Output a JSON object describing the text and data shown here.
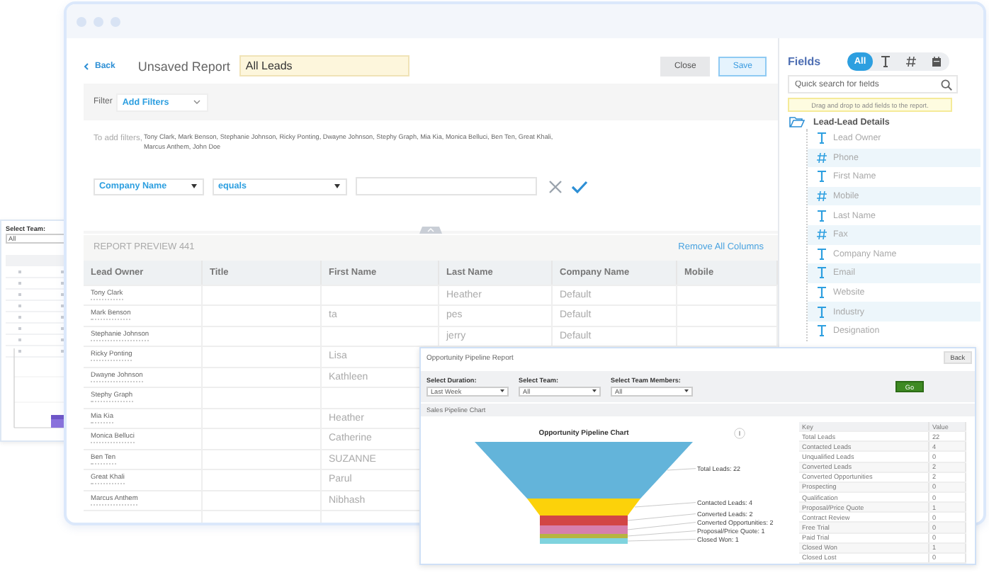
{
  "side_window": {
    "label": "Select Team:",
    "value": "All"
  },
  "header": {
    "back": "Back",
    "title": "Unsaved Report",
    "report_name": "All Leads",
    "buttons": [
      {
        "label": "Close",
        "kind": "secondary"
      },
      {
        "label": "Save",
        "kind": "primary"
      }
    ]
  },
  "filter": {
    "label": "Filter",
    "add_filters": "Add Filters",
    "hint": "To add filters,",
    "names": "Tony Clark, Mark Benson, Stephanie Johnson, Ricky Ponting, Dwayne Johnson, Stephy Graph, Mia Kia, Monica Belluci, Ben Ten, Great Khali, Marcus Anthem, John Doe",
    "field": "Company Name",
    "operator": "equals"
  },
  "preview": {
    "title": "REPORT PREVIEW 441",
    "remove_all": "Remove All Columns",
    "columns": [
      "Lead Owner",
      "Title",
      "First Name",
      "Last Name",
      "Company Name",
      "Mobile"
    ],
    "rows": [
      {
        "lead_owner": "Tony Clark",
        "last_name": "Heather",
        "company_name": "Default"
      },
      {
        "lead_owner": "Mark Benson",
        "first_name": "ta",
        "last_name": "pes",
        "company_name": "Default"
      },
      {
        "lead_owner": "Stephanie Johnson",
        "last_name": "jerry",
        "company_name": "Default"
      },
      {
        "lead_owner": "Ricky Ponting",
        "first_name": "Lisa"
      },
      {
        "lead_owner": "Dwayne Johnson",
        "first_name": "Kathleen"
      },
      {
        "lead_owner": "Stephy Graph"
      },
      {
        "lead_owner": "Mia Kia",
        "first_name": "Heather"
      },
      {
        "lead_owner": "Monica Belluci",
        "first_name": "Catherine"
      },
      {
        "lead_owner": "Ben Ten",
        "first_name": "SUZANNE"
      },
      {
        "lead_owner": "Great Khali",
        "first_name": "Parul"
      },
      {
        "lead_owner": "Marcus Anthem",
        "first_name": "Nibhash"
      }
    ]
  },
  "fields_panel": {
    "title": "Fields",
    "filters": [
      {
        "kind": "all",
        "label": "All",
        "selected": true
      },
      {
        "kind": "text",
        "selected": false
      },
      {
        "kind": "number",
        "selected": false
      },
      {
        "kind": "date",
        "selected": false
      }
    ],
    "search": {
      "placeholder": "Quick search for fields"
    },
    "hint": "Drag and drop to add fields to the report.",
    "group": "Lead-Lead Details",
    "items": [
      {
        "label": "Lead Owner",
        "kind": "text"
      },
      {
        "label": "Phone",
        "kind": "number"
      },
      {
        "label": "First Name",
        "kind": "text"
      },
      {
        "label": "Mobile",
        "kind": "number"
      },
      {
        "label": "Last Name",
        "kind": "text"
      },
      {
        "label": "Fax",
        "kind": "number"
      },
      {
        "label": "Company Name",
        "kind": "text"
      },
      {
        "label": "Email",
        "kind": "text"
      },
      {
        "label": "Website",
        "kind": "text"
      },
      {
        "label": "Industry",
        "kind": "text"
      },
      {
        "label": "Designation",
        "kind": "text"
      }
    ]
  },
  "pipeline_report": {
    "title": "Opportunity Pipeline Report",
    "back": "Back",
    "selects": [
      {
        "label": "Select Duration:",
        "value": "Last Week"
      },
      {
        "label": "Select Team:",
        "value": "All"
      },
      {
        "label": "Select Team Members:",
        "value": "All"
      }
    ],
    "go": "Go",
    "section": "Sales Pipeline Chart",
    "chart_title": "Opportunity Pipeline Chart",
    "funnel": [
      {
        "label": "Total Leads: 22",
        "color": "#63b4da"
      },
      {
        "label": "Contacted Leads: 4",
        "color": "#fcd20a"
      },
      {
        "label": "Converted Leads: 2",
        "color": "#d24545"
      },
      {
        "label": "Converted Opportunities: 2",
        "color": "#d77fad"
      },
      {
        "label": "Proposal/Price Quote: 1",
        "color": "#b7b441"
      },
      {
        "label": "Closed Won: 1",
        "color": "#7fd3de"
      }
    ],
    "table": {
      "columns": [
        "Key",
        "Value"
      ],
      "rows": [
        [
          "Total Leads",
          "22"
        ],
        [
          "Contacted Leads",
          "4"
        ],
        [
          "Unqualified Leads",
          "0"
        ],
        [
          "Converted Leads",
          "2"
        ],
        [
          "Converted Opportunities",
          "2"
        ],
        [
          "Prospecting",
          "0"
        ],
        [
          "Qualification",
          "0"
        ],
        [
          "Proposal/Price Quote",
          "1"
        ],
        [
          "Contract Review",
          "0"
        ],
        [
          "Free Trial",
          "0"
        ],
        [
          "Paid Trial",
          "0"
        ],
        [
          "Closed Won",
          "1"
        ],
        [
          "Closed Lost",
          "0"
        ]
      ]
    }
  }
}
